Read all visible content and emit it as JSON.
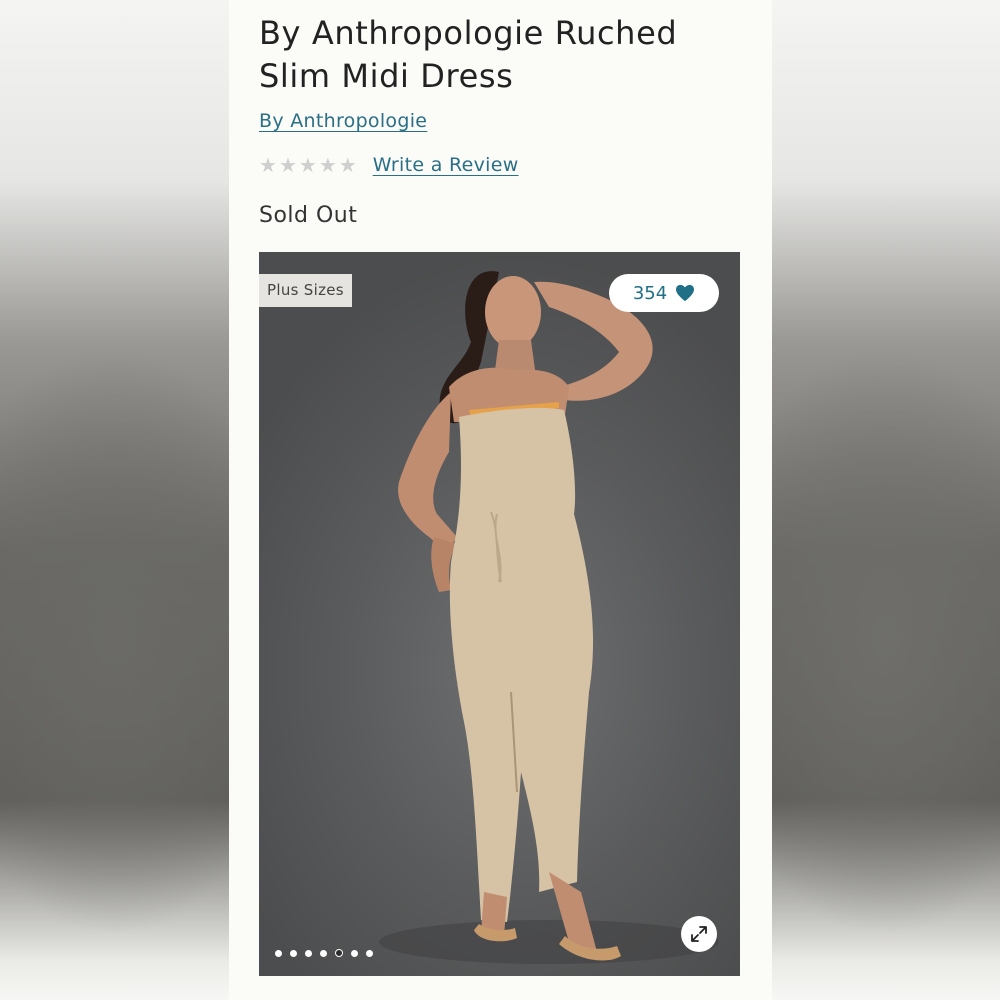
{
  "product": {
    "title": "By Anthropologie Ruched Slim Midi Dress",
    "brand_link": "By Anthropologie",
    "rating": {
      "stars_filled": 0,
      "stars_total": 5
    },
    "review_link": "Write a Review",
    "stock_status": "Sold Out"
  },
  "gallery": {
    "tag": "Plus Sizes",
    "likes_count": "354",
    "slide_count": 7,
    "active_slide": 5,
    "icons": {
      "like": "heart-icon",
      "expand": "expand-icon"
    }
  },
  "colors": {
    "link": "#2a6f86",
    "accent": "#1f6f86",
    "star_empty": "#cfcfcf"
  }
}
